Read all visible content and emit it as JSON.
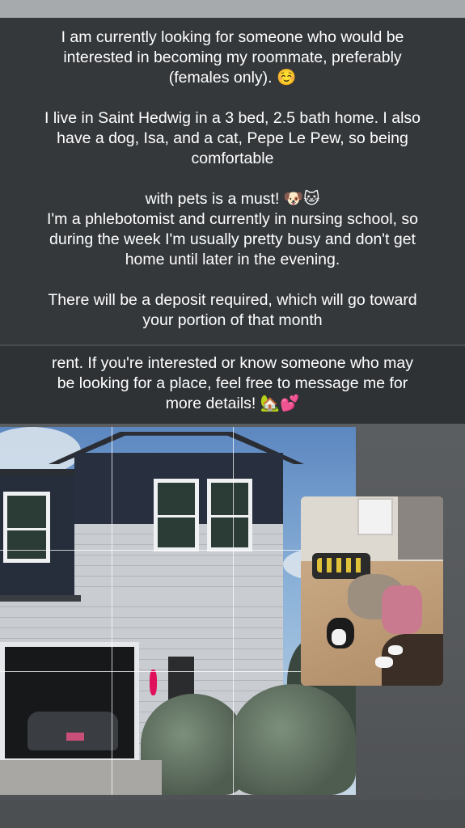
{
  "post": {
    "paragraph1": "I am currently looking for someone who would be\ninterested in becoming my roommate, preferably\n(females only). ☺️\n\nI live in Saint Hedwig in a 3 bed, 2.5 bath home. I also\nhave a dog, Isa, and a cat, Pepe Le Pew, so being\ncomfortable\n\nwith pets is a must! 🐶🐱\nI'm a phlebotomist and currently in nursing school, so\nduring the week I'm usually pretty busy and don't get\nhome until later in the evening.\n\nThere will be a deposit required, which will go toward\nyour portion of that month",
    "paragraph2": "rent. If you're interested or know someone who may\nbe looking for a place, feel free to message me for\nmore details! 🏡💕"
  },
  "colors": {
    "text_panel": "#35383b",
    "background": "#4a4d50",
    "text": "#ffffff"
  }
}
